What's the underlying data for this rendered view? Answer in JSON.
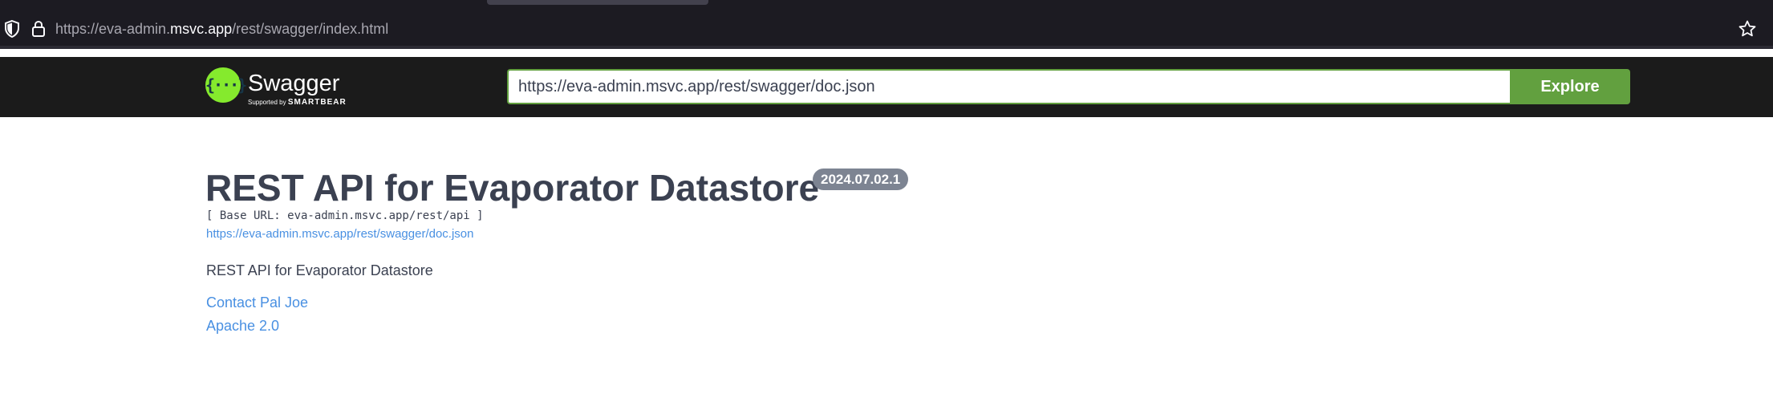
{
  "browser": {
    "url_prefix": "https://eva-admin.",
    "url_domain": "msvc.app",
    "url_path": "/rest/swagger/index.html"
  },
  "swagger": {
    "logo_text": "Swagger",
    "logo_sub_prefix": "Supported by",
    "logo_sub_brand": "SMARTBEAR",
    "spec_url_value": "https://eva-admin.msvc.app/rest/swagger/doc.json",
    "explore_label": "Explore"
  },
  "info": {
    "title": "REST API for Evaporator Datastore",
    "version": "2024.07.02.1",
    "base_url": "[ Base URL: eva-admin.msvc.app/rest/api ]",
    "spec_link": "https://eva-admin.msvc.app/rest/swagger/doc.json",
    "description": "REST API for Evaporator Datastore",
    "contact": "Contact Pal Joe",
    "license": "Apache 2.0"
  },
  "icons": {
    "shield": "shield-icon",
    "lock": "lock-icon",
    "star": "star-icon",
    "logo": "swagger-logo-icon"
  },
  "colors": {
    "accent_green": "#62a03f",
    "logo_green": "#85ea2d",
    "link_blue": "#4990e2",
    "text_dark": "#3b4151",
    "badge_gray": "#7d8492"
  }
}
